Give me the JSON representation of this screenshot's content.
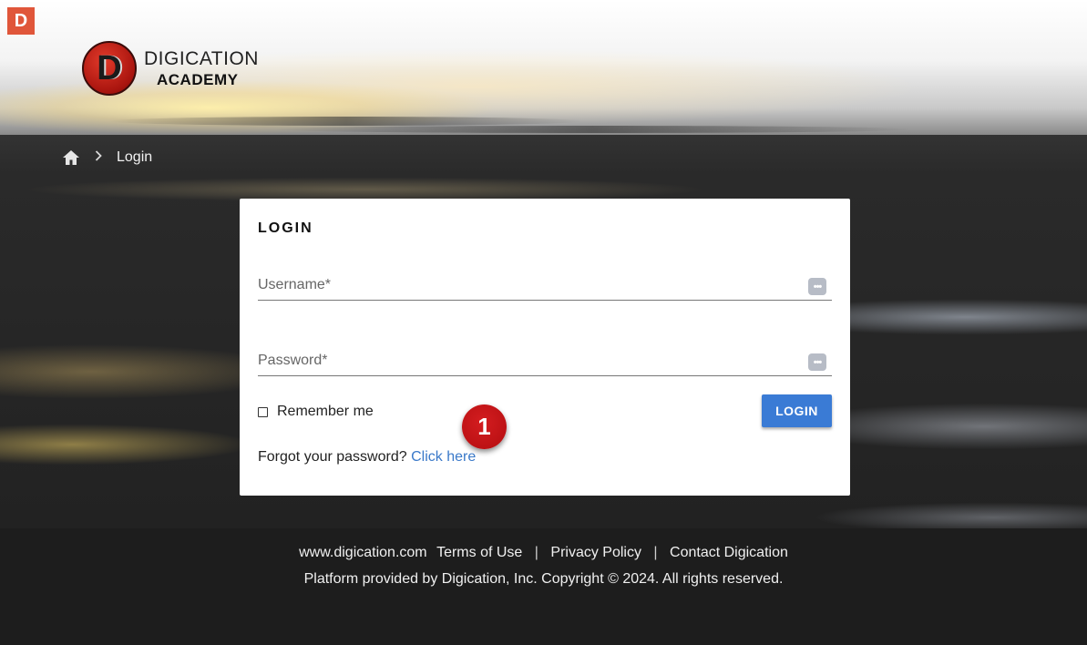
{
  "app": {
    "small_logo": "D"
  },
  "brand": {
    "mark": "D",
    "line1": "DIGICATION",
    "line2": "ACADEMY"
  },
  "breadcrumb": {
    "home_icon": "home-icon",
    "separator_icon": "chevron-right-icon",
    "current": "Login"
  },
  "login_card": {
    "title": "LOGIN",
    "username": {
      "placeholder": "Username*",
      "value": ""
    },
    "password": {
      "placeholder": "Password*",
      "value": ""
    },
    "field_icon": "dots-icon",
    "remember_label": "Remember me",
    "login_button": "LOGIN",
    "forgot_text": "Forgot your password?",
    "forgot_link": "Click here"
  },
  "annotation": {
    "step": "1"
  },
  "footer": {
    "links": [
      "www.digication.com",
      "Terms of Use",
      "Privacy Policy",
      "Contact Digication"
    ],
    "separator": "|",
    "copyright": "Platform provided by Digication, Inc. Copyright © 2024. All rights reserved."
  },
  "colors": {
    "accent": "#3a7bd5",
    "link": "#3a79c9",
    "brand_red": "#e0563a",
    "badge_red": "#c4161a"
  }
}
